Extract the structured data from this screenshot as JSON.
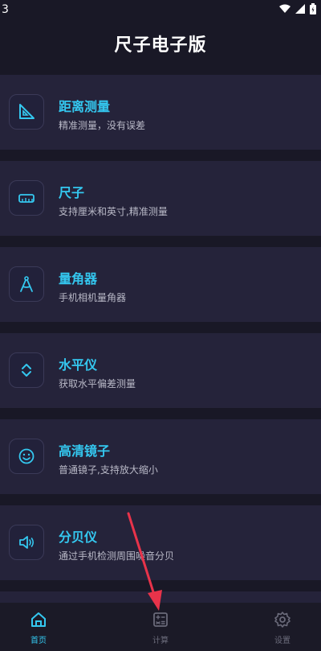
{
  "status": {
    "time": "3"
  },
  "header": {
    "title": "尺子电子版"
  },
  "features": [
    {
      "title": "距离测量",
      "subtitle": "精准测量，没有误差",
      "icon": "set-square-icon"
    },
    {
      "title": "尺子",
      "subtitle": "支持厘米和英寸,精准测量",
      "icon": "ruler-icon"
    },
    {
      "title": "量角器",
      "subtitle": "手机相机量角器",
      "icon": "compass-icon"
    },
    {
      "title": "水平仪",
      "subtitle": "获取水平偏差测量",
      "icon": "level-icon"
    },
    {
      "title": "高清镜子",
      "subtitle": "普通镜子,支持放大缩小",
      "icon": "smiley-icon"
    },
    {
      "title": "分贝仪",
      "subtitle": "通过手机检测周围噪音分贝",
      "icon": "speaker-icon"
    }
  ],
  "tabbar": {
    "tabs": [
      {
        "label": "首页",
        "icon": "home-icon",
        "active": true
      },
      {
        "label": "计算",
        "icon": "calculator-icon",
        "active": false
      },
      {
        "label": "设置",
        "icon": "gear-icon",
        "active": false
      }
    ]
  },
  "colors": {
    "accent": "#34c8f0",
    "background": "#191826",
    "card": "#25233a",
    "arrow": "#e8334a"
  }
}
